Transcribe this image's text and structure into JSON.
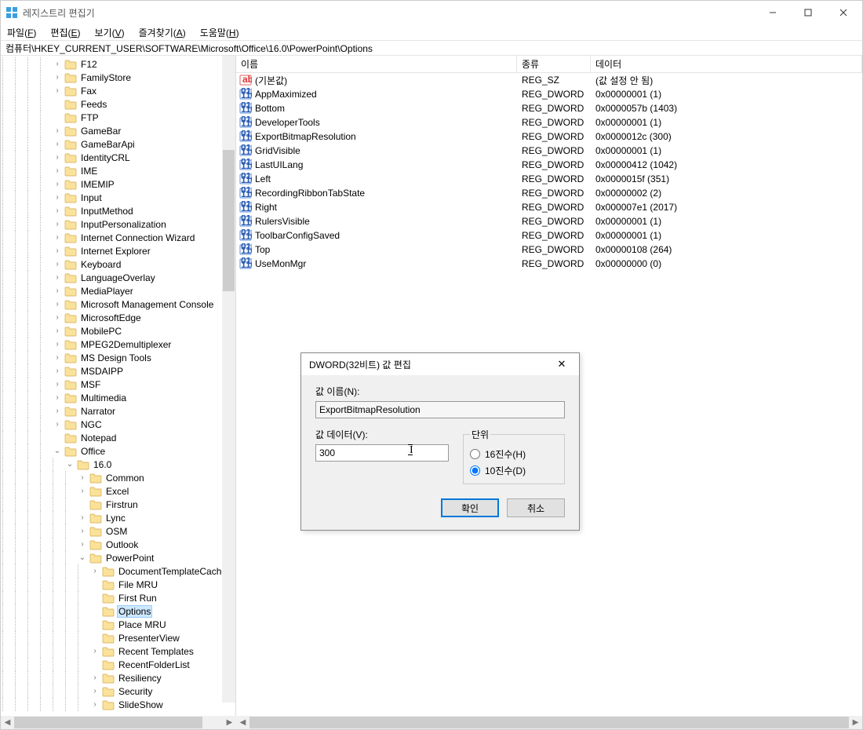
{
  "window": {
    "title": "레지스트리 편집기",
    "menus": [
      {
        "label": "파일",
        "u": "F"
      },
      {
        "label": "편집",
        "u": "E"
      },
      {
        "label": "보기",
        "u": "V"
      },
      {
        "label": "즐겨찾기",
        "u": "A"
      },
      {
        "label": "도움말",
        "u": "H"
      }
    ],
    "address": "컴퓨터\\HKEY_CURRENT_USER\\SOFTWARE\\Microsoft\\Office\\16.0\\PowerPoint\\Options"
  },
  "list": {
    "cols": {
      "name": "이름",
      "type": "종류",
      "data": "데이터"
    },
    "rows": [
      {
        "icon": "sz",
        "name": "(기본값)",
        "type": "REG_SZ",
        "data": "(값 설정 안 됨)"
      },
      {
        "icon": "dw",
        "name": "AppMaximized",
        "type": "REG_DWORD",
        "data": "0x00000001 (1)"
      },
      {
        "icon": "dw",
        "name": "Bottom",
        "type": "REG_DWORD",
        "data": "0x0000057b (1403)"
      },
      {
        "icon": "dw",
        "name": "DeveloperTools",
        "type": "REG_DWORD",
        "data": "0x00000001 (1)"
      },
      {
        "icon": "dw",
        "name": "ExportBitmapResolution",
        "type": "REG_DWORD",
        "data": "0x0000012c (300)"
      },
      {
        "icon": "dw",
        "name": "GridVisible",
        "type": "REG_DWORD",
        "data": "0x00000001 (1)"
      },
      {
        "icon": "dw",
        "name": "LastUILang",
        "type": "REG_DWORD",
        "data": "0x00000412 (1042)"
      },
      {
        "icon": "dw",
        "name": "Left",
        "type": "REG_DWORD",
        "data": "0x0000015f (351)"
      },
      {
        "icon": "dw",
        "name": "RecordingRibbonTabState",
        "type": "REG_DWORD",
        "data": "0x00000002 (2)"
      },
      {
        "icon": "dw",
        "name": "Right",
        "type": "REG_DWORD",
        "data": "0x000007e1 (2017)"
      },
      {
        "icon": "dw",
        "name": "RulersVisible",
        "type": "REG_DWORD",
        "data": "0x00000001 (1)"
      },
      {
        "icon": "dw",
        "name": "ToolbarConfigSaved",
        "type": "REG_DWORD",
        "data": "0x00000001 (1)"
      },
      {
        "icon": "dw",
        "name": "Top",
        "type": "REG_DWORD",
        "data": "0x00000108 (264)"
      },
      {
        "icon": "dw",
        "name": "UseMonMgr",
        "type": "REG_DWORD",
        "data": "0x00000000 (0)"
      }
    ]
  },
  "tree": [
    {
      "d": 4,
      "exp": ">",
      "label": "F12"
    },
    {
      "d": 4,
      "exp": ">",
      "label": "FamilyStore"
    },
    {
      "d": 4,
      "exp": ">",
      "label": "Fax"
    },
    {
      "d": 4,
      "exp": "",
      "label": "Feeds"
    },
    {
      "d": 4,
      "exp": "",
      "label": "FTP"
    },
    {
      "d": 4,
      "exp": ">",
      "label": "GameBar"
    },
    {
      "d": 4,
      "exp": ">",
      "label": "GameBarApi"
    },
    {
      "d": 4,
      "exp": ">",
      "label": "IdentityCRL"
    },
    {
      "d": 4,
      "exp": ">",
      "label": "IME"
    },
    {
      "d": 4,
      "exp": ">",
      "label": "IMEMIP"
    },
    {
      "d": 4,
      "exp": ">",
      "label": "Input"
    },
    {
      "d": 4,
      "exp": ">",
      "label": "InputMethod"
    },
    {
      "d": 4,
      "exp": ">",
      "label": "InputPersonalization"
    },
    {
      "d": 4,
      "exp": ">",
      "label": "Internet Connection Wizard"
    },
    {
      "d": 4,
      "exp": ">",
      "label": "Internet Explorer"
    },
    {
      "d": 4,
      "exp": ">",
      "label": "Keyboard"
    },
    {
      "d": 4,
      "exp": ">",
      "label": "LanguageOverlay"
    },
    {
      "d": 4,
      "exp": ">",
      "label": "MediaPlayer"
    },
    {
      "d": 4,
      "exp": ">",
      "label": "Microsoft Management Console"
    },
    {
      "d": 4,
      "exp": ">",
      "label": "MicrosoftEdge"
    },
    {
      "d": 4,
      "exp": ">",
      "label": "MobilePC"
    },
    {
      "d": 4,
      "exp": ">",
      "label": "MPEG2Demultiplexer"
    },
    {
      "d": 4,
      "exp": ">",
      "label": "MS Design Tools"
    },
    {
      "d": 4,
      "exp": ">",
      "label": "MSDAIPP"
    },
    {
      "d": 4,
      "exp": ">",
      "label": "MSF"
    },
    {
      "d": 4,
      "exp": ">",
      "label": "Multimedia"
    },
    {
      "d": 4,
      "exp": ">",
      "label": "Narrator"
    },
    {
      "d": 4,
      "exp": ">",
      "label": "NGC"
    },
    {
      "d": 4,
      "exp": "",
      "label": "Notepad"
    },
    {
      "d": 4,
      "exp": "v",
      "label": "Office"
    },
    {
      "d": 5,
      "exp": "v",
      "label": "16.0"
    },
    {
      "d": 6,
      "exp": ">",
      "label": "Common"
    },
    {
      "d": 6,
      "exp": ">",
      "label": "Excel"
    },
    {
      "d": 6,
      "exp": "",
      "label": "Firstrun"
    },
    {
      "d": 6,
      "exp": ">",
      "label": "Lync"
    },
    {
      "d": 6,
      "exp": ">",
      "label": "OSM"
    },
    {
      "d": 6,
      "exp": ">",
      "label": "Outlook"
    },
    {
      "d": 6,
      "exp": "v",
      "label": "PowerPoint"
    },
    {
      "d": 7,
      "exp": ">",
      "label": "DocumentTemplateCache"
    },
    {
      "d": 7,
      "exp": "",
      "label": "File MRU"
    },
    {
      "d": 7,
      "exp": "",
      "label": "First Run"
    },
    {
      "d": 7,
      "exp": "",
      "label": "Options",
      "sel": true
    },
    {
      "d": 7,
      "exp": "",
      "label": "Place MRU"
    },
    {
      "d": 7,
      "exp": "",
      "label": "PresenterView"
    },
    {
      "d": 7,
      "exp": ">",
      "label": "Recent Templates"
    },
    {
      "d": 7,
      "exp": "",
      "label": "RecentFolderList"
    },
    {
      "d": 7,
      "exp": ">",
      "label": "Resiliency"
    },
    {
      "d": 7,
      "exp": ">",
      "label": "Security"
    },
    {
      "d": 7,
      "exp": ">",
      "label": "SlideShow"
    }
  ],
  "dialog": {
    "title": "DWORD(32비트) 값 편집",
    "name_label": "값 이름(N):",
    "name_value": "ExportBitmapResolution",
    "data_label": "값 데이터(V):",
    "data_value": "300",
    "base_legend": "단위",
    "radio_hex": "16진수(H)",
    "radio_dec": "10진수(D)",
    "ok": "확인",
    "cancel": "취소"
  }
}
